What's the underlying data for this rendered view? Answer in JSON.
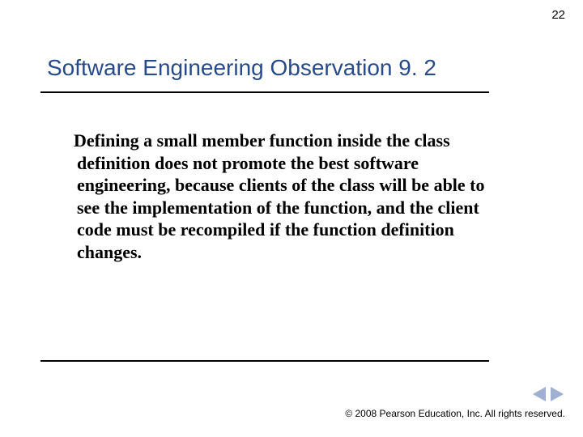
{
  "page_number": "22",
  "title": "Software Engineering Observation 9. 2",
  "body": "Defining a small member function inside the class definition does not promote the best software engineering, because clients of the class will be able to see the implementation of the function, and the client code must be recompiled if the function definition changes.",
  "copyright": "© 2008 Pearson Education, Inc.  All rights reserved.",
  "icons": {
    "prev": "triangle-left",
    "next": "triangle-right"
  }
}
